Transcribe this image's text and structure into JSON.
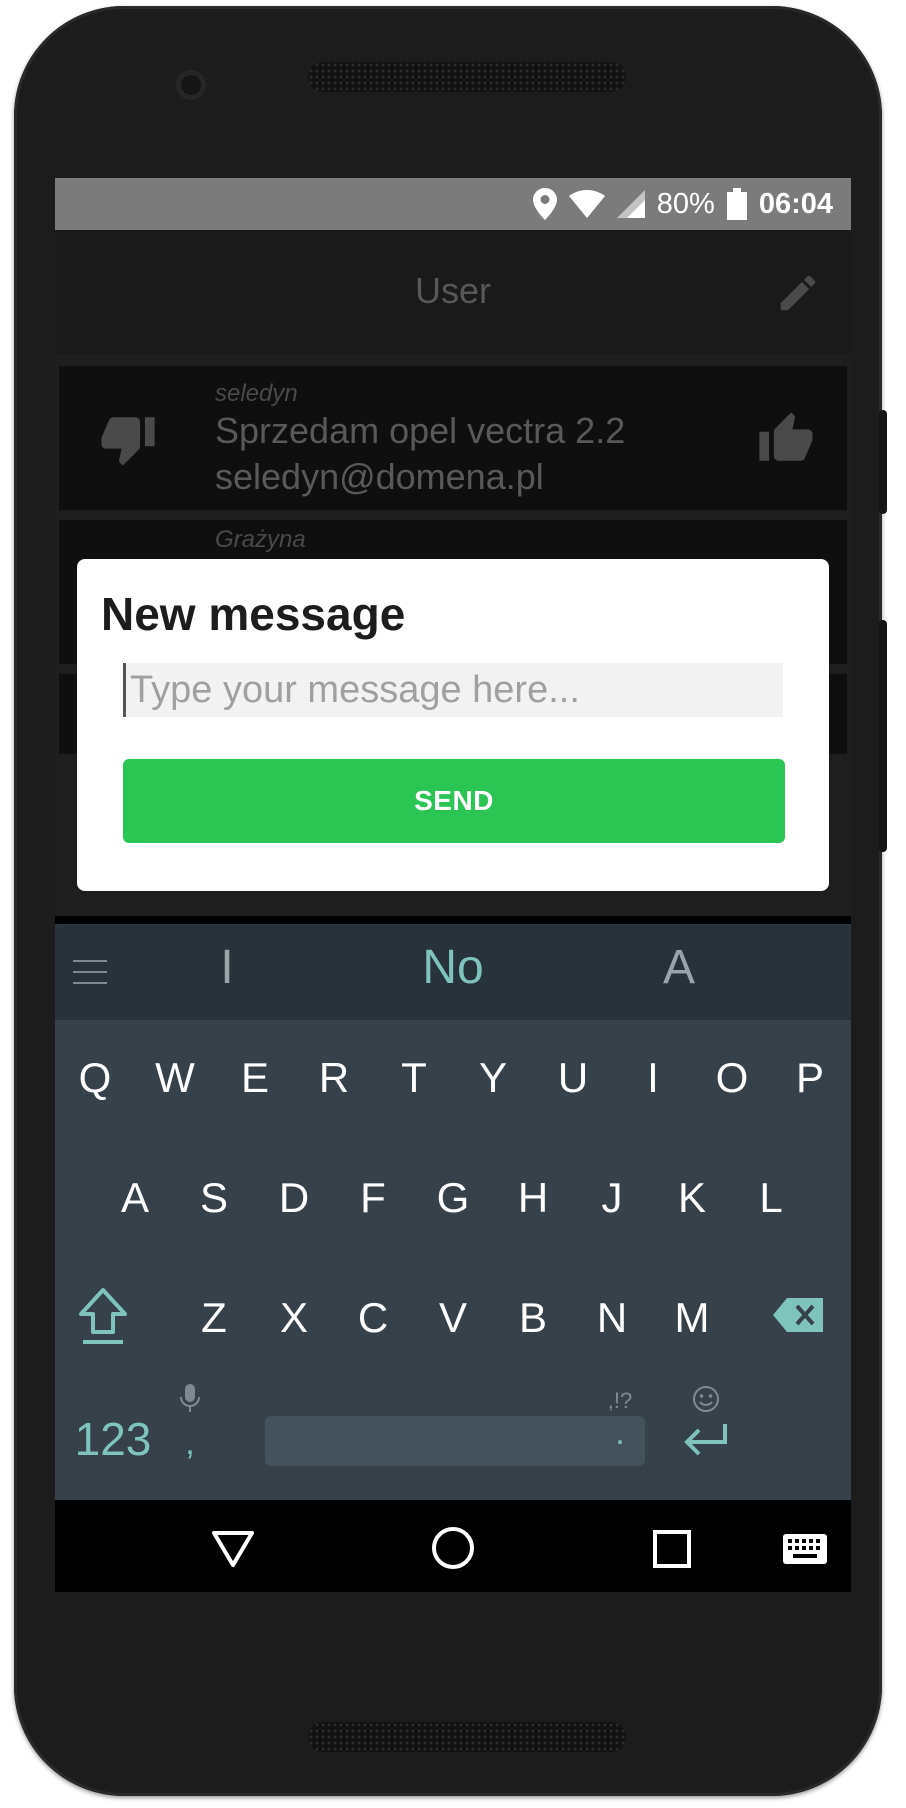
{
  "status_bar": {
    "battery": "80%",
    "time": "06:04"
  },
  "app_bar": {
    "title": "User"
  },
  "messages": [
    {
      "user": "seledyn",
      "text_line1": "Sprzedam opel vectra 2.2",
      "text_line2": "seledyn@domena.pl"
    },
    {
      "user": "Grażyna"
    }
  ],
  "dialog": {
    "title": "New message",
    "input_placeholder": "Type your message here...",
    "input_value": "",
    "send_label": "SEND"
  },
  "keyboard": {
    "suggestions": [
      "I",
      "No",
      "A"
    ],
    "row1": [
      "Q",
      "W",
      "E",
      "R",
      "T",
      "Y",
      "U",
      "I",
      "O",
      "P"
    ],
    "row2": [
      "A",
      "S",
      "D",
      "F",
      "G",
      "H",
      "J",
      "K",
      "L"
    ],
    "row3": [
      "Z",
      "X",
      "C",
      "V",
      "B",
      "N",
      "M"
    ],
    "symbols_key": "123",
    "comma_key": ",",
    "period_key": ".",
    "punct_hint": ",!?"
  },
  "colors": {
    "send_button": "#2bc553",
    "keyboard_bg": "#37414a",
    "keyboard_accent": "#7ec4bd",
    "status_bar": "#7b7b7b"
  }
}
